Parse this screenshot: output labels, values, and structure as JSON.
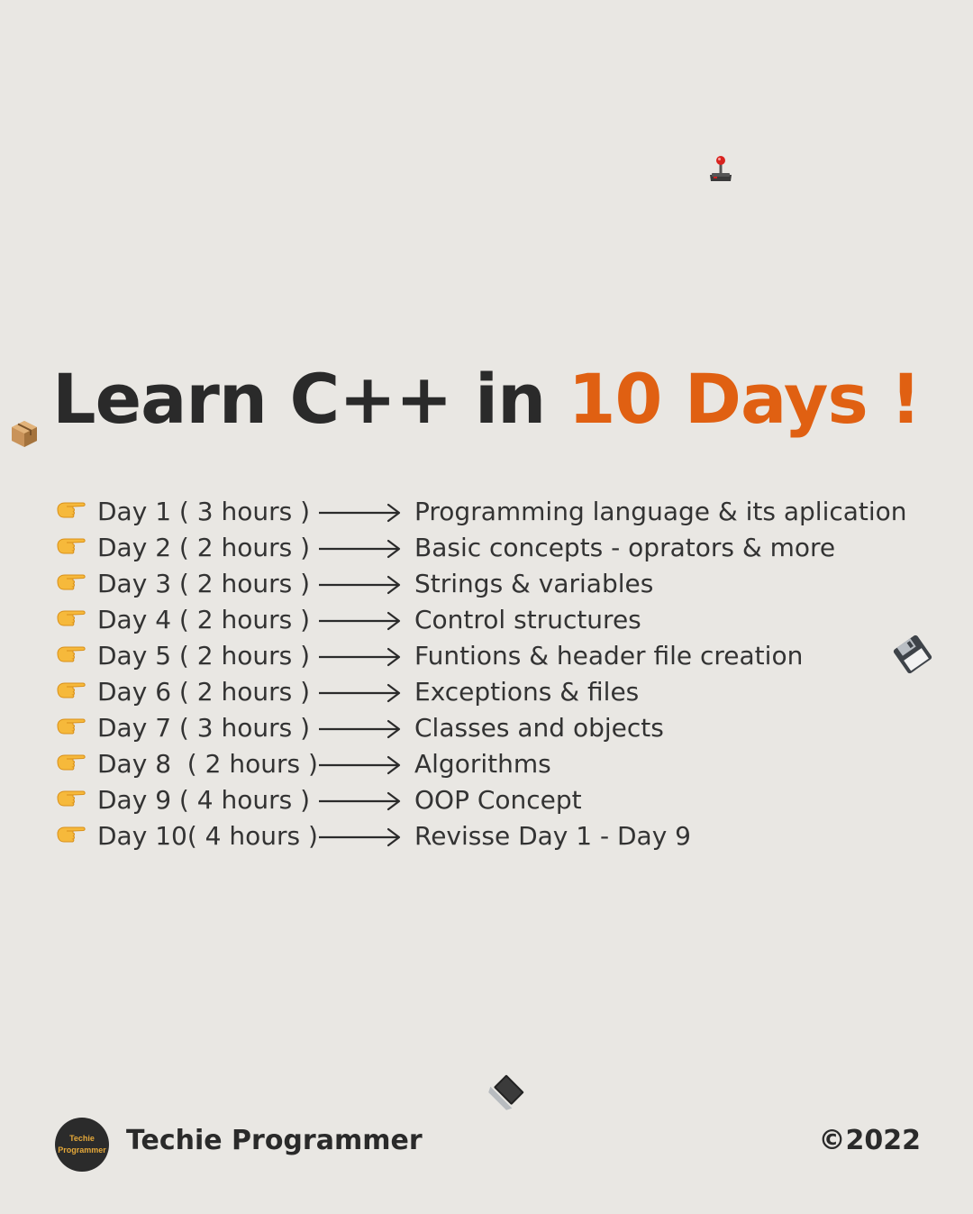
{
  "title": {
    "prefix": "Learn C++ in ",
    "highlight": "10 Days !",
    "accent_color": "#e06012"
  },
  "bullet_icon": "pointing-hand-icon",
  "arrow_icon": "long-right-arrow-icon",
  "schedule": [
    {
      "day": "Day 1 ( 3 hours )",
      "topic": "Programming language & its aplication"
    },
    {
      "day": "Day 2 ( 2 hours )",
      "topic": "Basic concepts - oprators & more"
    },
    {
      "day": "Day 3 ( 2 hours )",
      "topic": "Strings & variables"
    },
    {
      "day": "Day 4 ( 2 hours )",
      "topic": "Control structures"
    },
    {
      "day": "Day 5 ( 2 hours )",
      "topic": "Funtions & header file creation"
    },
    {
      "day": "Day 6 ( 2 hours )",
      "topic": "Exceptions & files"
    },
    {
      "day": "Day 7 ( 3 hours )",
      "topic": "Classes and objects"
    },
    {
      "day": "Day 8  ( 2 hours )",
      "topic": "Algorithms"
    },
    {
      "day": "Day 9 ( 4 hours )",
      "topic": "OOP Concept"
    },
    {
      "day": "Day 10( 4 hours )",
      "topic": "Revisse Day 1 - Day 9"
    }
  ],
  "decorations": [
    "joystick-icon",
    "package-icon",
    "floppy-disk-icon",
    "laptop-icon"
  ],
  "footer": {
    "logo_line1": "Techie",
    "logo_line2": "Programmer",
    "brand": "Techie Programmer",
    "copyright": "©2022"
  }
}
